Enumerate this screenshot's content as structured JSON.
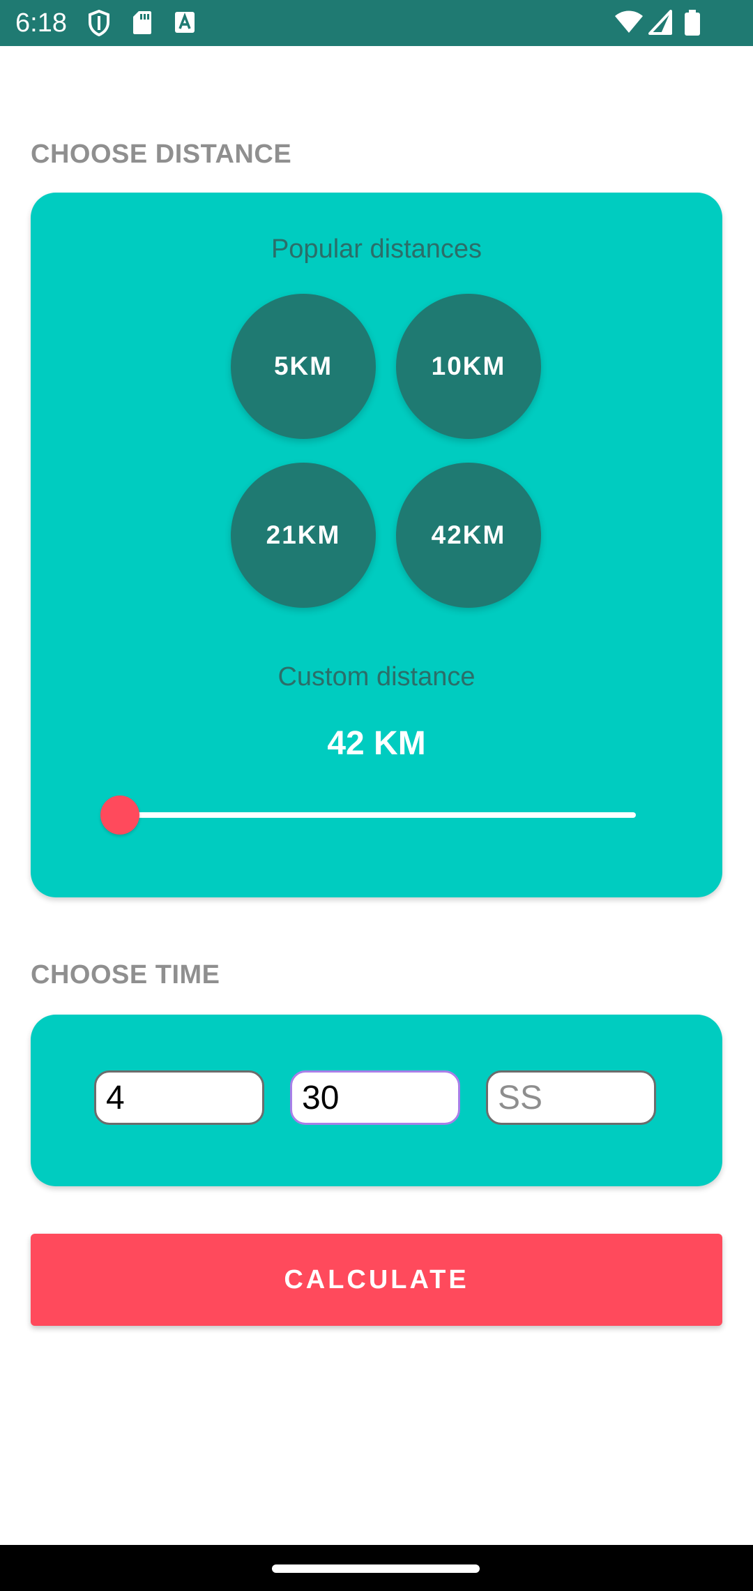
{
  "status_bar": {
    "time": "6:18",
    "left_icons": [
      "shield-icon",
      "sd-card-icon",
      "font-a-icon"
    ],
    "right_icons": [
      "wifi-icon",
      "signal-icon",
      "battery-icon"
    ],
    "color": "#1f7a72"
  },
  "distance_section": {
    "label": "CHOOSE DISTANCE",
    "popular_title": "Popular distances",
    "popular_options": [
      {
        "label": "5KM"
      },
      {
        "label": "10KM"
      },
      {
        "label": "21KM"
      },
      {
        "label": "42KM"
      }
    ],
    "custom_title": "Custom distance",
    "custom_value": "42 KM",
    "slider_position": 0.0
  },
  "time_section": {
    "label": "CHOOSE TIME",
    "hours": {
      "value": "4",
      "placeholder": ""
    },
    "minutes": {
      "value": "30",
      "placeholder": ""
    },
    "seconds": {
      "value": "",
      "placeholder": "SS"
    }
  },
  "calculate_label": "CALCULATE",
  "colors": {
    "accent": "#00ccc0",
    "dark_teal": "#1f7a72",
    "button": "#ff4a5c",
    "section_label": "#8f8f8f"
  }
}
